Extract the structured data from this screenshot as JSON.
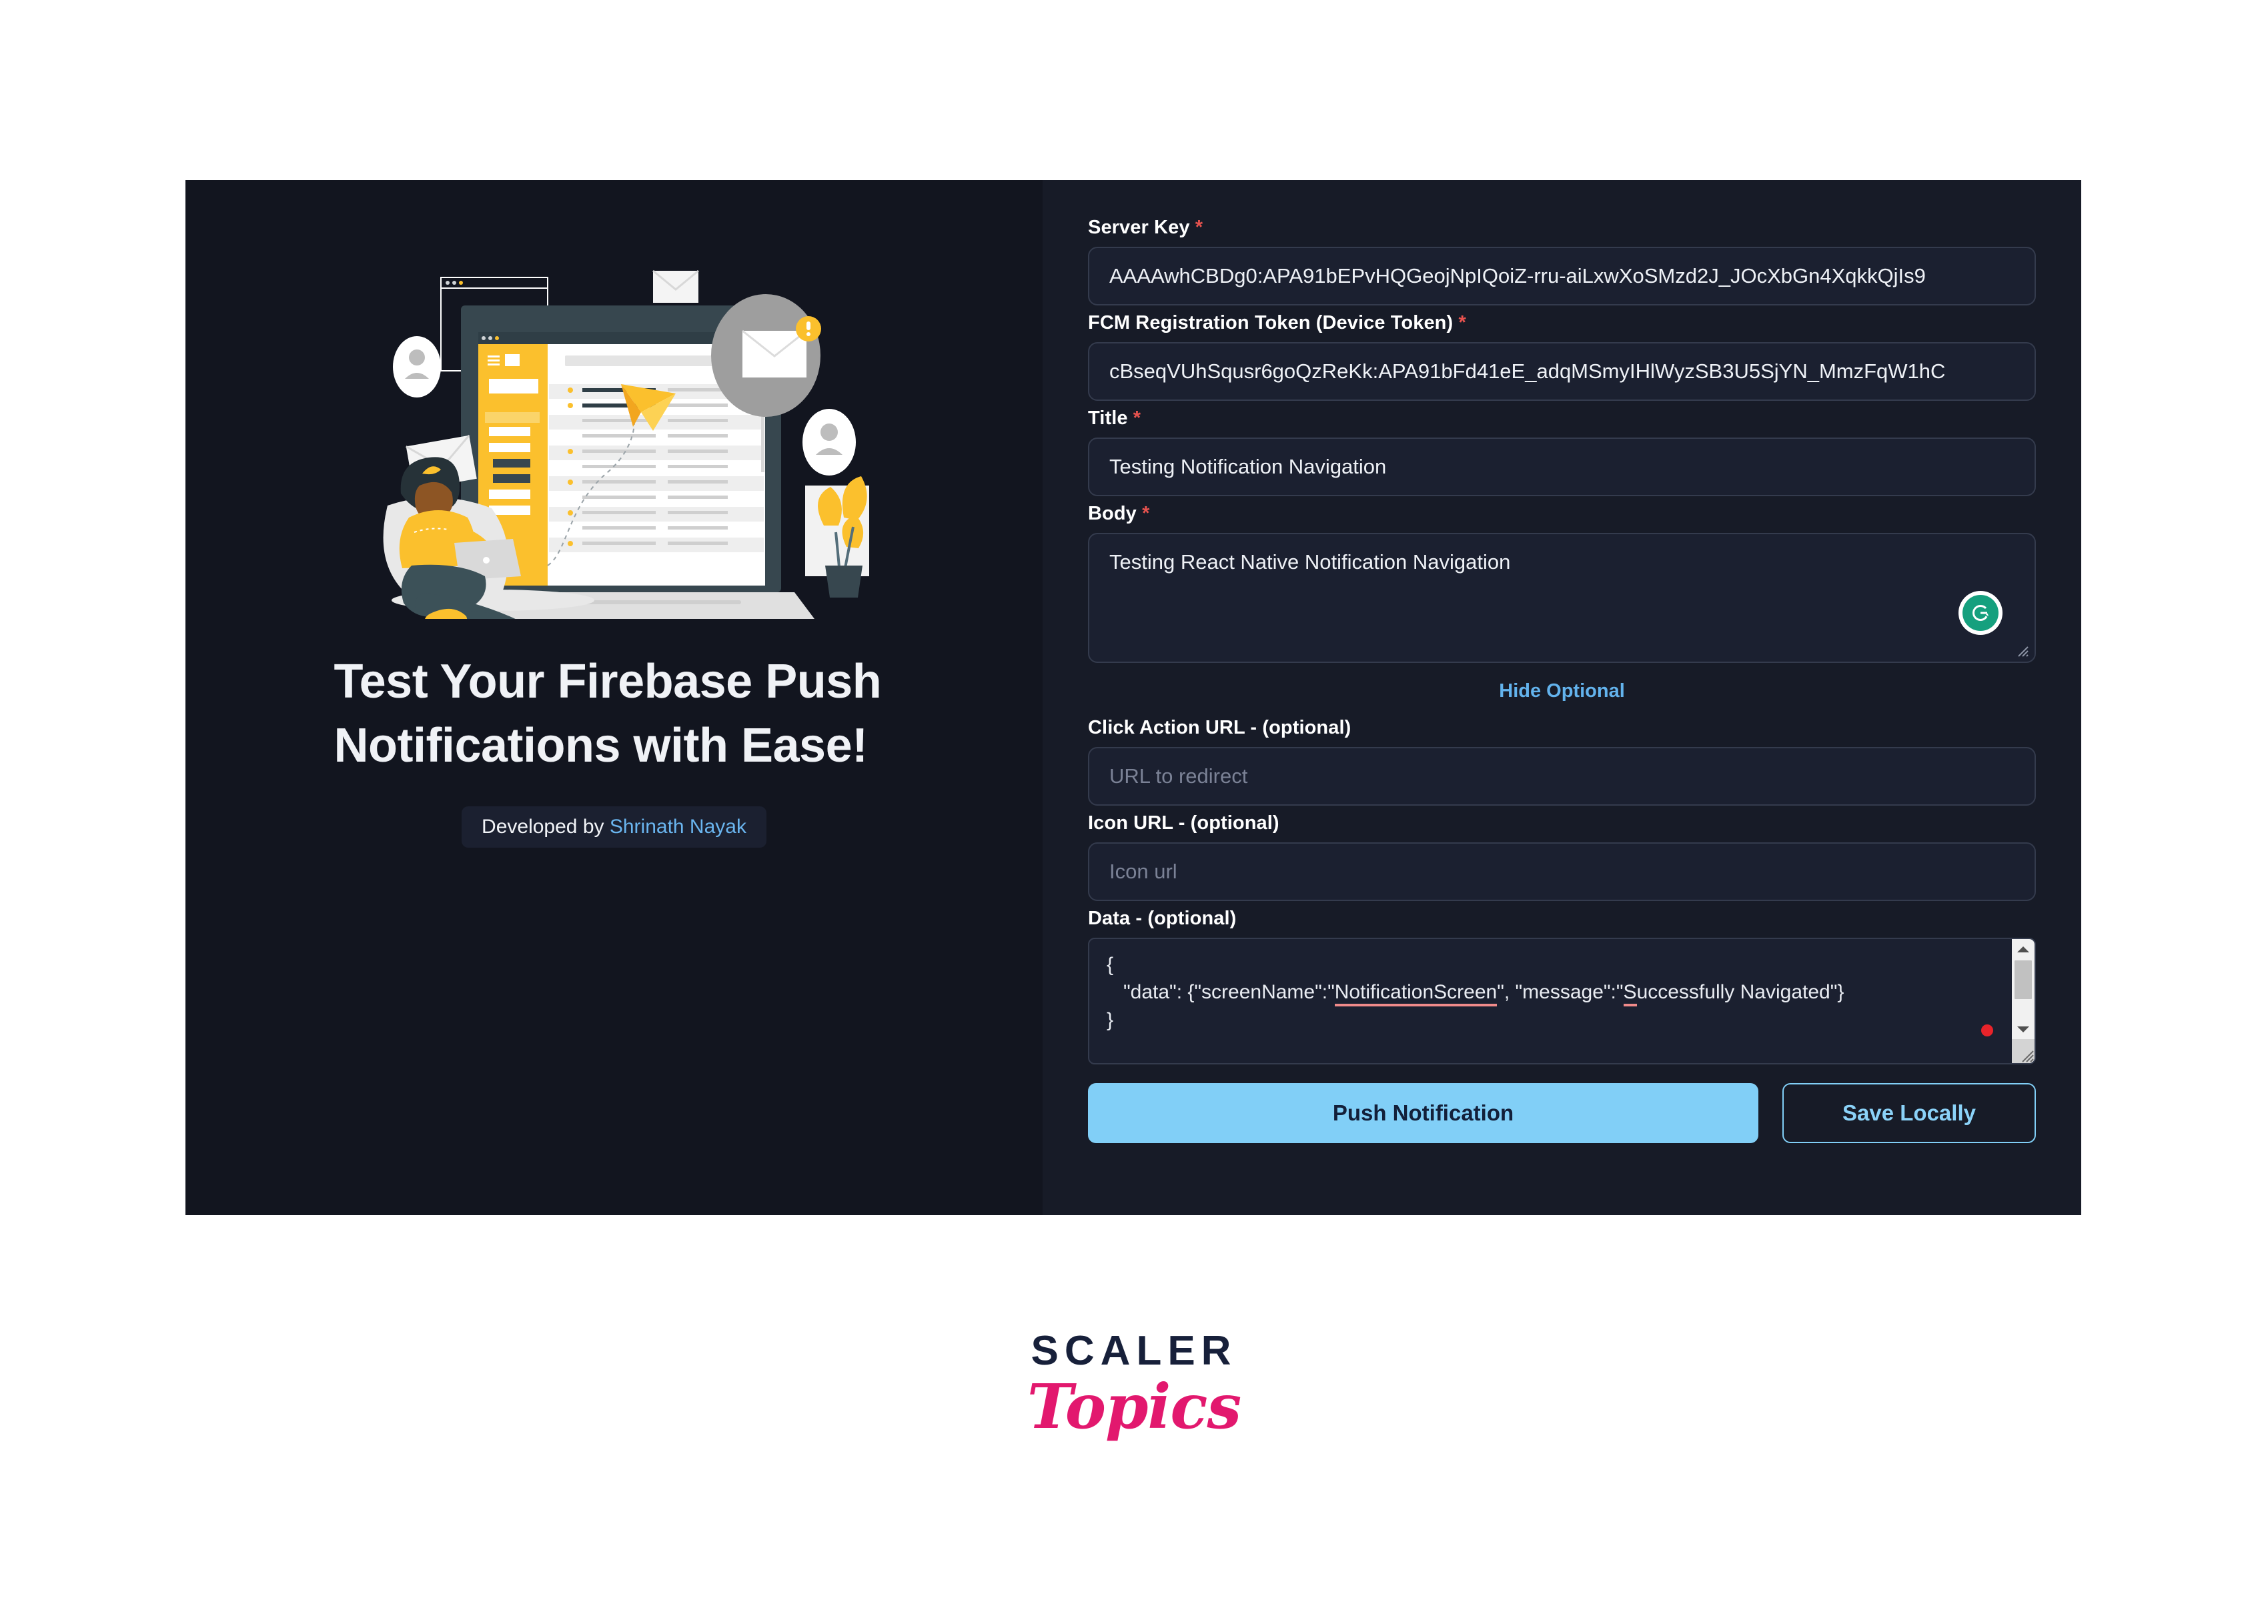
{
  "hero": {
    "title_line1": "Test Your Firebase Push",
    "title_line2": "Notifications with Ease!",
    "developed_by_prefix": "Developed by ",
    "developer_name": "Shrinath Nayak",
    "illustration_name": "email-campaign-illustration"
  },
  "form": {
    "server_key": {
      "label": "Server Key",
      "required_marker": "*",
      "value": "AAAAwhCBDg0:APA91bEPvHQGeojNpIQoiZ-rru-aiLxwXoSMzd2J_JOcXbGn4XqkkQjIs9"
    },
    "fcm_token": {
      "label": "FCM Registration Token (Device Token)",
      "required_marker": "*",
      "value": "cBseqVUhSqusr6goQzReKk:APA91bFd41eE_adqMSmyIHlWyzSB3U5SjYN_MmzFqW1hC"
    },
    "title": {
      "label": "Title",
      "required_marker": "*",
      "value": "Testing Notification Navigation"
    },
    "body": {
      "label": "Body",
      "required_marker": "*",
      "value": "Testing React Native Notification Navigation"
    },
    "hide_optional_label": "Hide Optional",
    "click_action_url": {
      "label": "Click Action URL - (optional)",
      "value": "",
      "placeholder": "URL to redirect"
    },
    "icon_url": {
      "label": "Icon URL - (optional)",
      "value": "",
      "placeholder": "Icon url"
    },
    "data": {
      "label": "Data - (optional)",
      "line1": "{",
      "line2_prefix": "   \"data\": {\"screenName\":\"",
      "line2_misspelled_1": "NotificationScreen",
      "line2_mid": "\", \"message\":\"",
      "line2_misspelled_2": "S",
      "line2_suffix": "uccessfully Navigated\"}",
      "line3": "}"
    },
    "push_button_label": "Push Notification",
    "save_button_label": "Save Locally"
  },
  "footer": {
    "logo_primary": "SCALER",
    "logo_secondary": "Topics"
  },
  "colors": {
    "panel_bg": "#171b27",
    "panel_left_bg": "#12151f",
    "accent_blue": "#81cff7",
    "link_blue": "#63b3ed",
    "required_red": "#e8534f",
    "grammarly_green": "#15a07e",
    "logo_pink": "#e2186e",
    "logo_navy": "#17203a",
    "illustration_yellow": "#fbc02d",
    "illustration_teal": "#37474f"
  }
}
